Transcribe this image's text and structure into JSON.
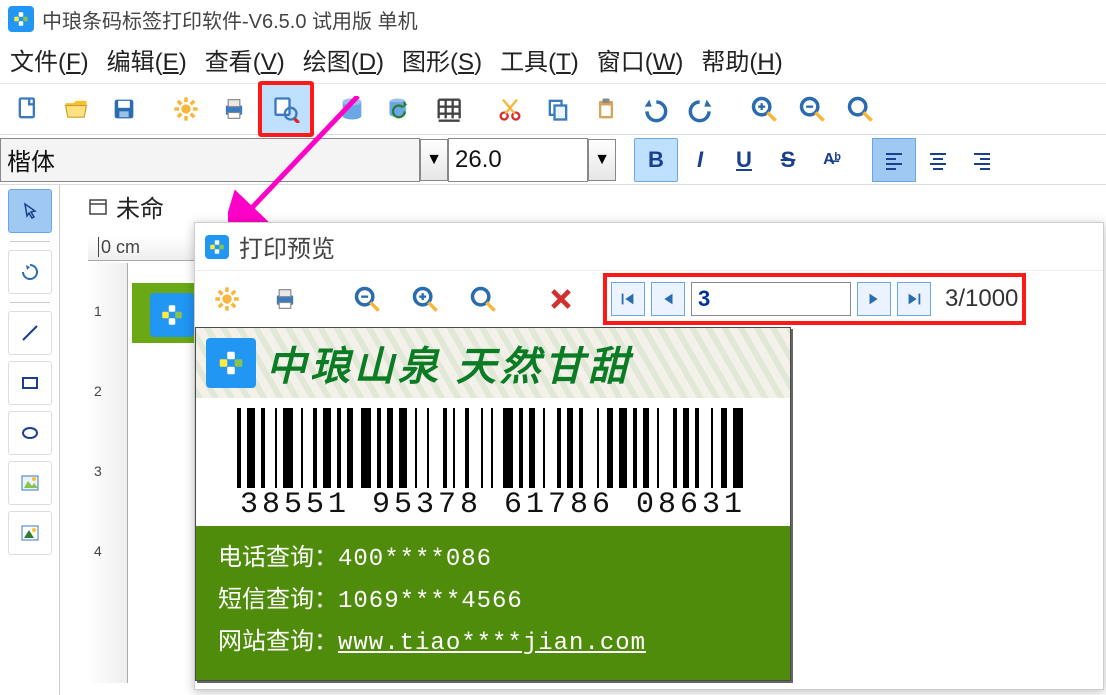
{
  "app": {
    "title": "中琅条码标签打印软件-V6.5.0 试用版 单机"
  },
  "menu": {
    "items": [
      {
        "label": "文件",
        "key": "F"
      },
      {
        "label": "编辑",
        "key": "E"
      },
      {
        "label": "查看",
        "key": "V"
      },
      {
        "label": "绘图",
        "key": "D"
      },
      {
        "label": "图形",
        "key": "S"
      },
      {
        "label": "工具",
        "key": "T"
      },
      {
        "label": "窗口",
        "key": "W"
      },
      {
        "label": "帮助",
        "key": "H"
      }
    ]
  },
  "font_bar": {
    "font_name": "楷体",
    "font_size": "26.0"
  },
  "doc": {
    "tab_label": "未命"
  },
  "ruler": {
    "top_label": "0 cm",
    "left_marks": [
      "1",
      "2",
      "3",
      "4"
    ]
  },
  "preview": {
    "title": "打印预览",
    "nav": {
      "page_value": "3",
      "counter": "3/1000"
    },
    "label": {
      "headline": "中琅山泉  天然甘甜",
      "barcode_number": "38551 95378 61786 08631",
      "info": {
        "phone_label": "电话查询：",
        "phone_value": "400****086",
        "sms_label": "短信查询：",
        "sms_value": "1069****4566",
        "web_label": "网站查询：",
        "web_value": "www.tiao****jian.com"
      }
    }
  }
}
